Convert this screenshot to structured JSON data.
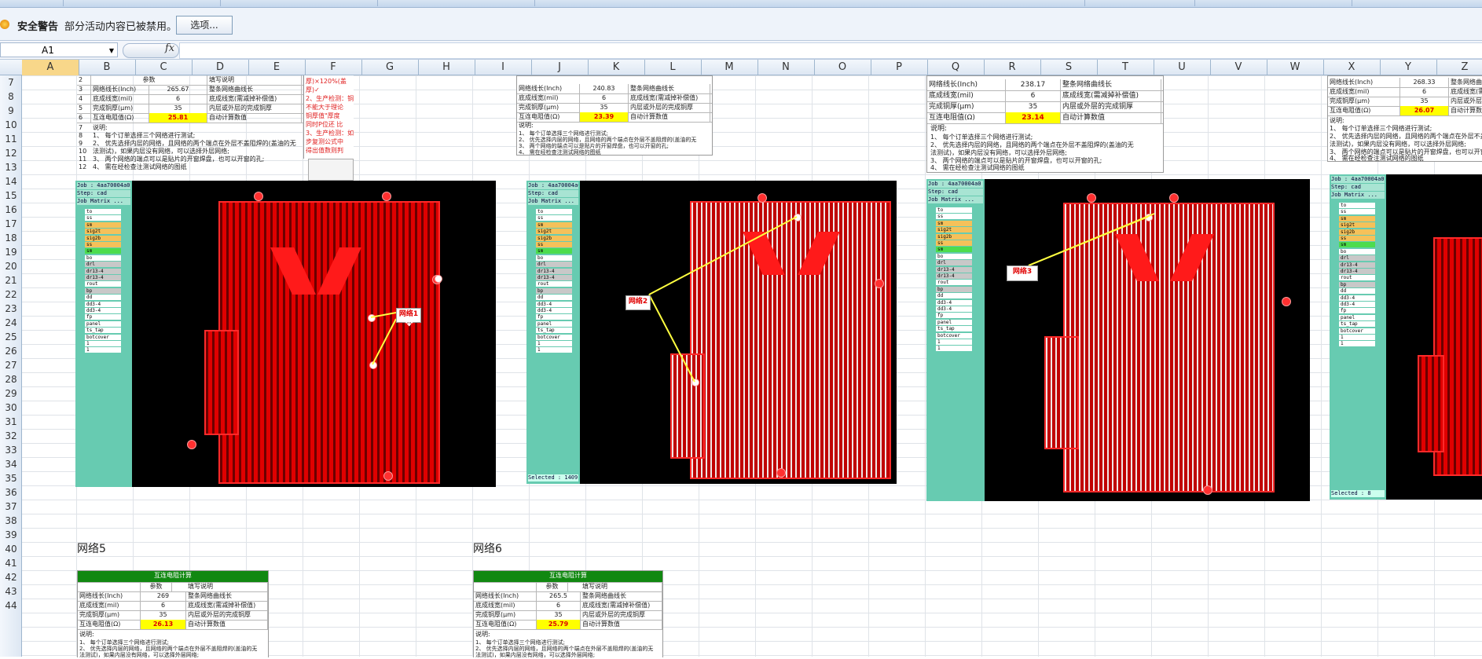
{
  "security_bar": {
    "title": "安全警告",
    "message": "部分活动内容已被禁用。",
    "options_button": "选项..."
  },
  "formula_bar": {
    "cell_ref": "A1",
    "fx_label": "fx",
    "value": ""
  },
  "columns": [
    "A",
    "B",
    "C",
    "D",
    "E",
    "F",
    "G",
    "H",
    "I",
    "J",
    "K",
    "L",
    "M",
    "N",
    "O",
    "P",
    "Q",
    "R",
    "S",
    "T",
    "U",
    "V",
    "W",
    "X",
    "Y",
    "Z"
  ],
  "rows": [
    "7",
    "8",
    "9",
    "10",
    "11",
    "12",
    "13",
    "14",
    "15",
    "16",
    "17",
    "18",
    "19",
    "20",
    "21",
    "22",
    "23",
    "24",
    "25",
    "26",
    "27",
    "28",
    "29",
    "30",
    "31",
    "32",
    "33",
    "34",
    "35",
    "36",
    "37",
    "38",
    "39",
    "40",
    "41",
    "42",
    "43",
    "44"
  ],
  "table_common": {
    "header_param": "参数",
    "header_desc": "填写说明",
    "title": "互连电阻计算",
    "row_length_label": "网络线长(Inch)",
    "row_length_desc": "整条网络曲线长",
    "row_width_label": "底成线宽(mil)",
    "row_width_desc": "底成线宽(需减掉补偿值)",
    "row_thick_label": "完成铜厚(μm)",
    "row_thick_desc": "内层或外层的完成铜厚",
    "row_res_label": "互连电阻值(Ω)",
    "row_res_desc": "自动计算数值",
    "notes_title": "说明:",
    "note1": "1、 每个订单选择三个网络进行测试;",
    "note2": "2、 优先选择内层的网络，且网络的两个端点在外层不盖阻焊的(盖油的无",
    "note2b": "法测试)，如果内层没有网络，可以选择外层网络;",
    "note3": "3、 两个网络的端点可以是贴片的开窗焊盘，也可以开窗的孔;",
    "note4": "4、 需在经检查注测试网络的图纸"
  },
  "tables": [
    {
      "length": "265.67",
      "width": "6",
      "thick": "35",
      "res": "25.81",
      "row_nums": [
        "2",
        "3",
        "4",
        "5",
        "6",
        "7",
        "8",
        "9",
        "10",
        "11",
        "12"
      ]
    },
    {
      "length": "240.83",
      "width": "6",
      "thick": "35",
      "res": "23.39"
    },
    {
      "length": "238.17",
      "width": "6",
      "thick": "35",
      "res": "23.14"
    },
    {
      "length": "268.33",
      "width": "6",
      "thick": "35",
      "res": "26.07"
    },
    {
      "length": "269",
      "width": "6",
      "thick": "35",
      "res": "26.13"
    },
    {
      "length": "265.5",
      "width": "6",
      "thick": "35",
      "res": "25.79"
    }
  ],
  "red_notes": [
    "厚)×120%(盖",
    "厚)✓",
    "2、生产检测：铜",
    "不能大于理论",
    "铜厚值\"厚度",
    "同时P位还 比",
    "3、生产检测：如",
    "步复测公式中",
    "得出值数则判",
    "杂 1)"
  ],
  "cad_panel": {
    "job": "Job : 4aa70004a0",
    "step": "Step: cad",
    "matrix": "Job Matrix ...",
    "selected": "Selected : 1409",
    "selected2": "Selected : 8",
    "layers": [
      "to",
      "ss",
      "sm",
      "sig2t",
      "sig2b",
      "ss",
      "sm",
      "bo",
      "drl",
      "dr13-4",
      "dr13-4",
      "rout",
      "bp",
      "dd",
      "dd3-4",
      "dd3-4",
      "fp",
      "panel",
      "ts_tap",
      "botcover",
      "1",
      "1"
    ]
  },
  "callouts": [
    "网络1",
    "网络2",
    "网络3"
  ],
  "section_labels": [
    "网络5",
    "网络6"
  ]
}
